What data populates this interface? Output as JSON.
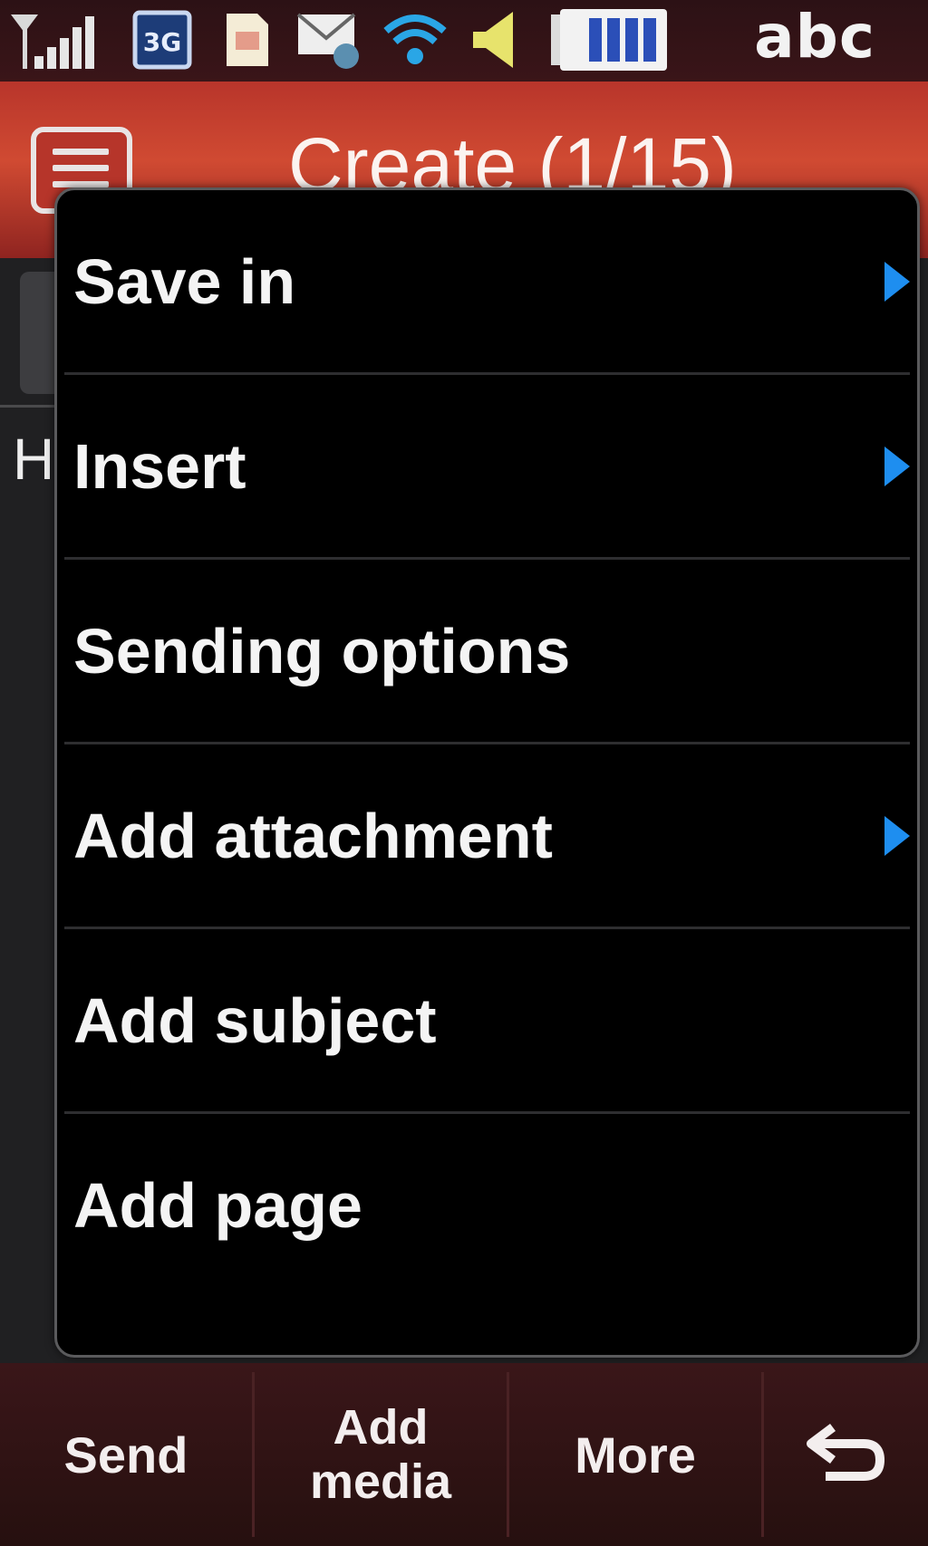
{
  "status_bar": {
    "icons": [
      "signal-strength-icon",
      "3g-icon",
      "sim-card-icon",
      "new-message-icon",
      "wifi-icon",
      "speaker-icon",
      "battery-icon"
    ],
    "input_mode": "abc"
  },
  "header": {
    "title": "Create (1/15)"
  },
  "background": {
    "partial_text": "H"
  },
  "popup_menu": {
    "items": [
      {
        "label": "Save in",
        "has_submenu": true
      },
      {
        "label": "Insert",
        "has_submenu": true
      },
      {
        "label": "Sending options",
        "has_submenu": false
      },
      {
        "label": "Add attachment",
        "has_submenu": true
      },
      {
        "label": "Add subject",
        "has_submenu": false
      },
      {
        "label": "Add page",
        "has_submenu": false
      }
    ],
    "arrow_color": "#1e8ef0"
  },
  "toolbar": {
    "send_label": "Send",
    "add_media_line1": "Add",
    "add_media_line2": "media",
    "more_label": "More",
    "back_icon": "back-arrow-icon"
  },
  "colors": {
    "title_bar": "#c23e2e",
    "popup_background": "#000000",
    "status_bar": "#2c1115"
  }
}
